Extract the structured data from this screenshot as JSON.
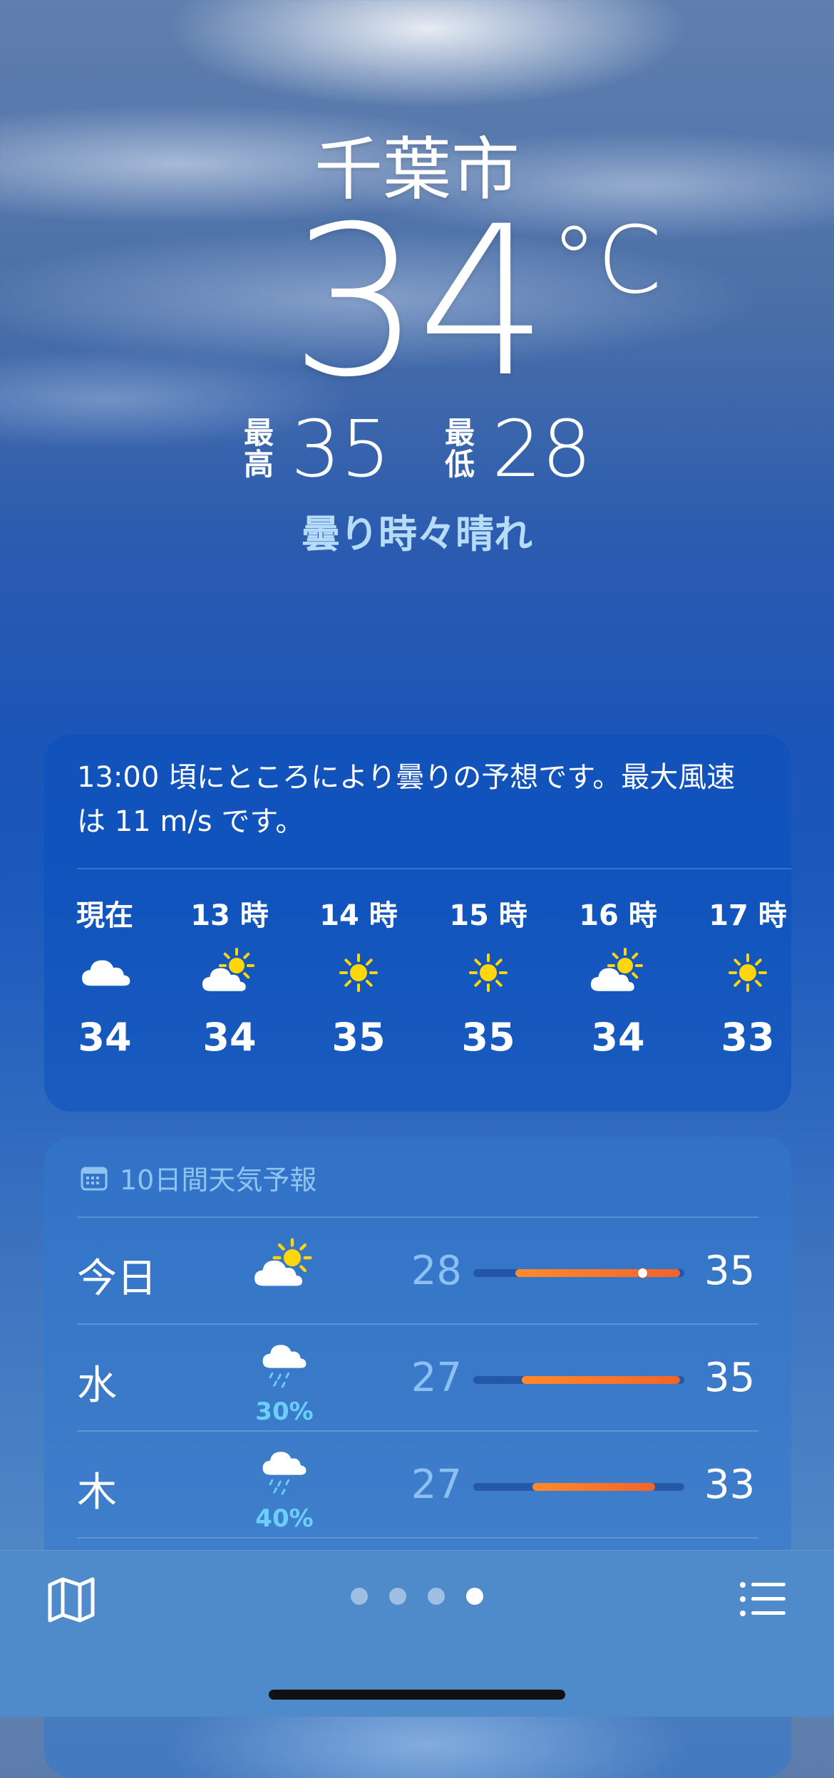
{
  "location": {
    "city": "千葉市"
  },
  "current": {
    "temperature": "34",
    "unit": "°C",
    "high_label_1": "最",
    "high_label_2": "高",
    "high": "35",
    "low_label_1": "最",
    "low_label_2": "低",
    "low": "28",
    "condition": "曇り時々晴れ"
  },
  "hourly": {
    "summary": "13:00 頃にところにより曇りの予想です。最大風速は 11 m/s です。",
    "items": [
      {
        "time": "現在",
        "icon": "cloud-icon",
        "temp": "34"
      },
      {
        "time": "13 時",
        "icon": "partly-sunny-icon",
        "temp": "34"
      },
      {
        "time": "14 時",
        "icon": "sun-icon",
        "temp": "35"
      },
      {
        "time": "15 時",
        "icon": "sun-icon",
        "temp": "35"
      },
      {
        "time": "16 時",
        "icon": "partly-sunny-icon",
        "temp": "34"
      },
      {
        "time": "17 時",
        "icon": "sun-icon",
        "temp": "33"
      }
    ]
  },
  "daily": {
    "title": "10日間天気予報",
    "range_min": 26,
    "range_max": 36,
    "current_temp_value": 34,
    "items": [
      {
        "day": "今日",
        "icon": "partly-sunny-icon",
        "precip": "",
        "low": "28",
        "high": "35",
        "low_value": 28,
        "high_value": 35.8,
        "show_current": true
      },
      {
        "day": "水",
        "icon": "rain-icon",
        "precip": "30%",
        "low": "27",
        "high": "35",
        "low_value": 28.3,
        "high_value": 35.8,
        "show_current": false
      },
      {
        "day": "木",
        "icon": "rain-icon",
        "precip": "40%",
        "low": "27",
        "high": "33",
        "low_value": 28.8,
        "high_value": 34.6,
        "show_current": false
      }
    ]
  },
  "bottom_bar": {
    "map_icon": "map-icon",
    "list_icon": "list-icon",
    "page_count": 4,
    "active_page": 4
  },
  "colors": {
    "accent_orange": "#f2642a",
    "condition_text": "#b6dcf7",
    "precip_text": "#6ad0fa",
    "low_temp_text": "#8cc0f2"
  }
}
